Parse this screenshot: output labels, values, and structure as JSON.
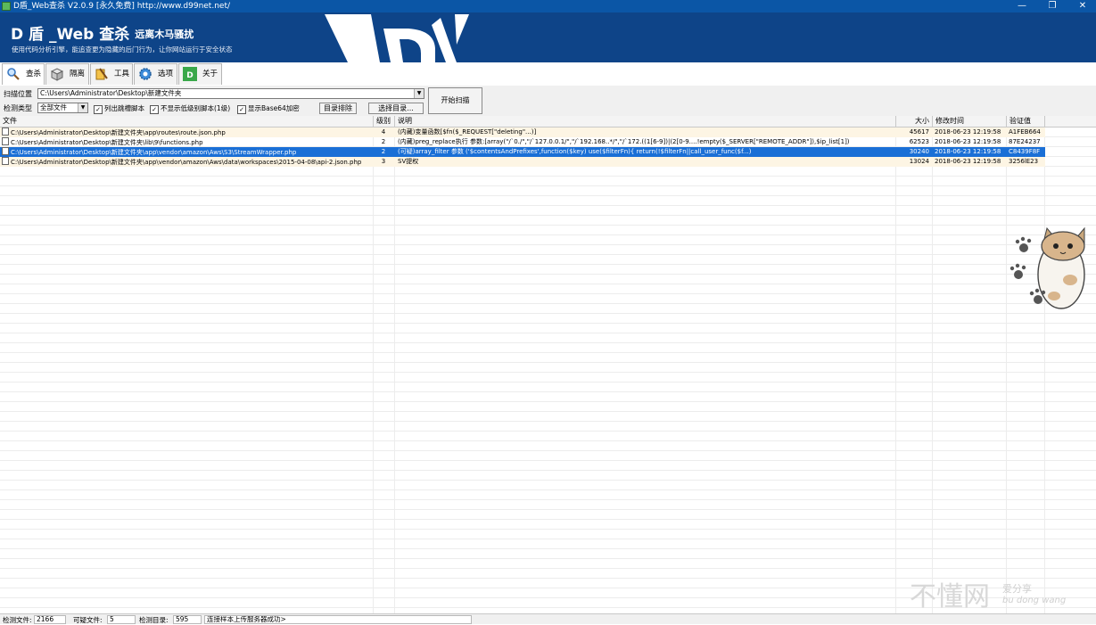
{
  "window": {
    "title": "D盾_Web查杀 V2.0.9 [永久免费] http://www.d99net.net/"
  },
  "banner": {
    "brand": "D 盾 _Web 查杀",
    "brand_sub": "远离木马骚扰",
    "slogan": "使用代码分析引擎，能追查更为隐藏的后门行为，让你网站运行于安全状态"
  },
  "tabs": [
    {
      "label": "查杀",
      "icon": "magnifier-icon",
      "active": true
    },
    {
      "label": "隔离",
      "icon": "box-icon"
    },
    {
      "label": "工具",
      "icon": "tools-icon"
    },
    {
      "label": "选项",
      "icon": "gear-icon"
    },
    {
      "label": "关于",
      "icon": "d-logo-icon"
    }
  ],
  "toolbar": {
    "scan_location_label": "扫描位置",
    "scan_path": "C:\\Users\\Administrator\\Desktop\\新建文件夹",
    "detect_type_label": "检测类型",
    "detect_type_value": "全部文件",
    "checkboxes": [
      {
        "label": "列出跳槽脚本",
        "checked": true
      },
      {
        "label": "不显示低级别脚本(1级)",
        "checked": true
      },
      {
        "label": "显示Base64加密",
        "checked": true
      }
    ],
    "dir_sort_label": "目录排除",
    "choose_dir_label": "选择目录...",
    "start_scan_label": "开始扫描"
  },
  "table": {
    "columns": [
      "文件",
      "级别",
      "说明",
      "大小",
      "修改时间",
      "验证值"
    ],
    "rows": [
      {
        "file": "C:\\Users\\Administrator\\Desktop\\新建文件夹\\app\\routes\\route.json.php",
        "level": "4",
        "desc": "(内藏)变量函数[$fn($_REQUEST[\"deleting\"...)]",
        "size": "45617",
        "mtime": "2018-06-23 12:19:58",
        "hash": "A1FEB664",
        "selected": false
      },
      {
        "file": "C:\\Users\\Administrator\\Desktop\\新建文件夹\\lib\\9\\functions.php",
        "level": "2",
        "desc": "(内藏)preg_replace执行 参数:[array(\"/`0./\",\"/`127.0.0.1/\",\"/`192.168..*/\",\"/`172.((1[6-9])|(2[0-9....!empty($_SERVER[\"REMOTE_ADDR\"]),$ip_list[1])",
        "size": "62523",
        "mtime": "2018-06-23 12:19:58",
        "hash": "87E24237",
        "selected": false
      },
      {
        "file": "C:\\Users\\Administrator\\Desktop\\新建文件夹\\app\\vendor\\amazon\\Aws\\S3\\StreamWrapper.php",
        "level": "2",
        "desc": "(可疑)array_filter 参数  ('$contentsAndPrefixes',function($key)  use($filterFn){ return(!$filterFn||call_user_func($f...)",
        "size": "30240",
        "mtime": "2018-06-23 12:19:58",
        "hash": "C8439F8F",
        "selected": true
      },
      {
        "file": "C:\\Users\\Administrator\\Desktop\\新建文件夹\\app\\vendor\\amazon\\Aws\\data\\workspaces\\2015-04-08\\api-2.json.php",
        "level": "3",
        "desc": "SV提权",
        "size": "13024",
        "mtime": "2018-06-23 12:19:58",
        "hash": "3256lE23",
        "selected": false
      }
    ]
  },
  "watermark": {
    "main": "不懂网",
    "side": "爱分享",
    "pinyin": "bu dong wang"
  },
  "status": {
    "files_label": "检测文件:",
    "files_value": "2166",
    "suspicious_label": "可疑文件:",
    "suspicious_value": "5",
    "dirs_label": "检测目录:",
    "dirs_value": "595",
    "message": "连接样本上传服务器成功>"
  }
}
